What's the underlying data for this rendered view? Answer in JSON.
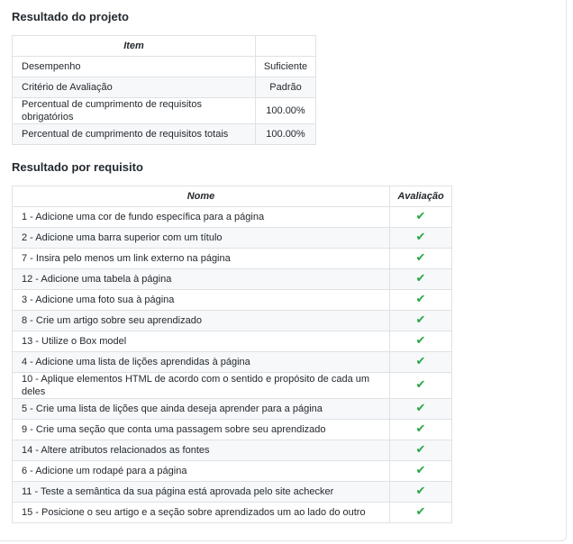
{
  "project_result": {
    "title": "Resultado do projeto",
    "header_item": "Item",
    "header_value": "",
    "rows": [
      {
        "item": "Desempenho",
        "value": "Suficiente"
      },
      {
        "item": "Critério de Avaliação",
        "value": "Padrão"
      },
      {
        "item": "Percentual de cumprimento de requisitos obrigatórios",
        "value": "100.00%"
      },
      {
        "item": "Percentual de cumprimento de requisitos totais",
        "value": "100.00%"
      }
    ]
  },
  "requirement_result": {
    "title": "Resultado por requisito",
    "header_name": "Nome",
    "header_eval": "Avaliação",
    "check_icon": "check-icon",
    "check_glyph": "✔",
    "check_color": "#28a745",
    "rows": [
      {
        "name": "1 - Adicione uma cor de fundo específica para a página",
        "passed": true
      },
      {
        "name": "2 - Adicione uma barra superior com um título",
        "passed": true
      },
      {
        "name": "7 - Insira pelo menos um link externo na página",
        "passed": true
      },
      {
        "name": "12 - Adicione uma tabela à página",
        "passed": true
      },
      {
        "name": "3 - Adicione uma foto sua à página",
        "passed": true
      },
      {
        "name": "8 - Crie um artigo sobre seu aprendizado",
        "passed": true
      },
      {
        "name": "13 - Utilize o Box model",
        "passed": true
      },
      {
        "name": "4 - Adicione uma lista de lições aprendidas à página",
        "passed": true
      },
      {
        "name": "10 - Aplique elementos HTML de acordo com o sentido e propósito de cada um deles",
        "passed": true
      },
      {
        "name": "5 - Crie uma lista de lições que ainda deseja aprender para a página",
        "passed": true
      },
      {
        "name": "9 - Crie uma seção que conta uma passagem sobre seu aprendizado",
        "passed": true
      },
      {
        "name": "14 - Altere atributos relacionados as fontes",
        "passed": true
      },
      {
        "name": "6 - Adicione um rodapé para a página",
        "passed": true
      },
      {
        "name": "11 - Teste a semântica da sua página está aprovada pelo site achecker",
        "passed": true
      },
      {
        "name": "15 - Posicione o seu artigo e a seção sobre aprendizados um ao lado do outro",
        "passed": true
      }
    ]
  }
}
